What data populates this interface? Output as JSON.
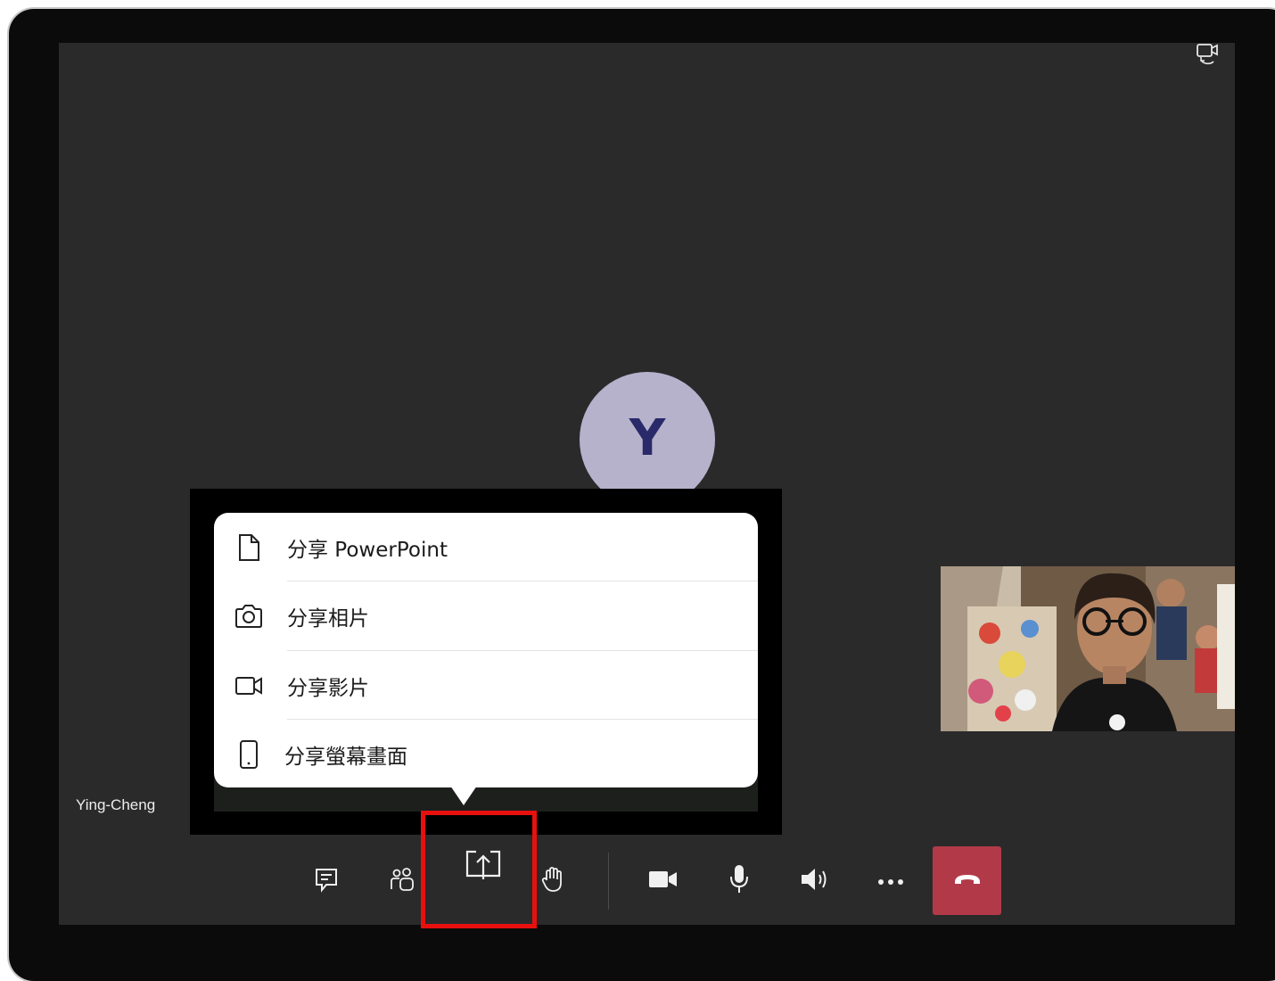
{
  "meeting": {
    "participant_initial": "Y",
    "participant_name": "Ying-Cheng"
  },
  "share_menu": {
    "items": [
      {
        "label": "分享 PowerPoint",
        "icon": "document-icon"
      },
      {
        "label": "分享相片",
        "icon": "camera-icon"
      },
      {
        "label": "分享影片",
        "icon": "video-icon"
      },
      {
        "label": "分享螢幕畫面",
        "icon": "phone-icon"
      }
    ]
  },
  "toolbar": {
    "buttons": [
      {
        "name": "chat",
        "icon": "chat-icon"
      },
      {
        "name": "participants",
        "icon": "people-icon"
      },
      {
        "name": "share",
        "icon": "share-screen-icon"
      },
      {
        "name": "raise-hand",
        "icon": "hand-icon"
      },
      {
        "name": "camera",
        "icon": "camera-on-icon"
      },
      {
        "name": "microphone",
        "icon": "microphone-icon"
      },
      {
        "name": "speaker",
        "icon": "speaker-icon"
      },
      {
        "name": "more",
        "icon": "more-icon"
      },
      {
        "name": "hang-up",
        "icon": "hang-up-icon"
      }
    ]
  },
  "colors": {
    "stage_bg": "#2a2a2b",
    "avatar_bg": "#b6b2cc",
    "avatar_text": "#2a2a6a",
    "end_call": "#b23a48",
    "highlight": "#e8100f"
  }
}
